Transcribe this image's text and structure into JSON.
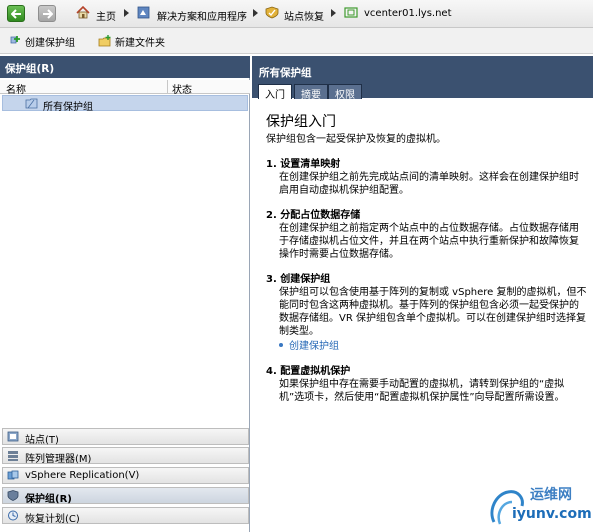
{
  "breadcrumb": {
    "items": [
      "主页",
      "解决方案和应用程序",
      "站点恢复",
      "vcenter01.lys.net"
    ]
  },
  "toolbar": {
    "create_group": "创建保护组",
    "new_folder": "新建文件夹"
  },
  "left_pane": {
    "title": "保护组(R)",
    "col_name": "名称",
    "col_status": "状态",
    "tree_item": "所有保护组"
  },
  "bottom_nav": [
    {
      "label": "站点(T)",
      "icon": "site-icon"
    },
    {
      "label": "阵列管理器(M)",
      "icon": "array-manager-icon"
    },
    {
      "label": "vSphere Replication(V)",
      "icon": "replication-icon"
    },
    {
      "label": "保护组(R)",
      "icon": "shield-icon",
      "active": true
    },
    {
      "label": "恢复计划(C)",
      "icon": "recovery-plan-icon"
    }
  ],
  "right_pane": {
    "title": "所有保护组",
    "tabs": [
      "入门",
      "摘要",
      "权限"
    ],
    "intro_title": "保护组入门",
    "intro_text": "保护组包含一起受保护及恢复的虚拟机。",
    "sections": [
      {
        "title": "1. 设置清单映射",
        "body": "在创建保护组之前先完成站点间的清单映射。这样会在创建保护组时启用自动虚拟机保护组配置。"
      },
      {
        "title": "2. 分配占位数据存储",
        "body": "在创建保护组之前指定两个站点中的占位数据存储。占位数据存储用于存储虚拟机占位文件，并且在两个站点中执行重新保护和故障恢复操作时需要占位数据存储。"
      },
      {
        "title": "3. 创建保护组",
        "body": "保护组可以包含使用基于阵列的复制或 vSphere 复制的虚拟机，但不能同时包含这两种虚拟机。基于阵列的保护组包含必须一起受保护的数据存储组。VR 保护组包含单个虚拟机。可以在创建保护组时选择复制类型。",
        "link": "创建保护组"
      },
      {
        "title": "4. 配置虚拟机保护",
        "body": "如果保护组中存在需要手动配置的虚拟机，请转到保护组的“虚拟机”选项卡，然后使用“配置虚拟机保护属性”向导配置所需设置。"
      }
    ]
  },
  "watermark": {
    "line1": "运维网",
    "line2": "iyunv.com"
  },
  "colors": {
    "header_bg": "#3b5170",
    "link": "#2366b5",
    "selected_row": "#c5d5ec"
  }
}
